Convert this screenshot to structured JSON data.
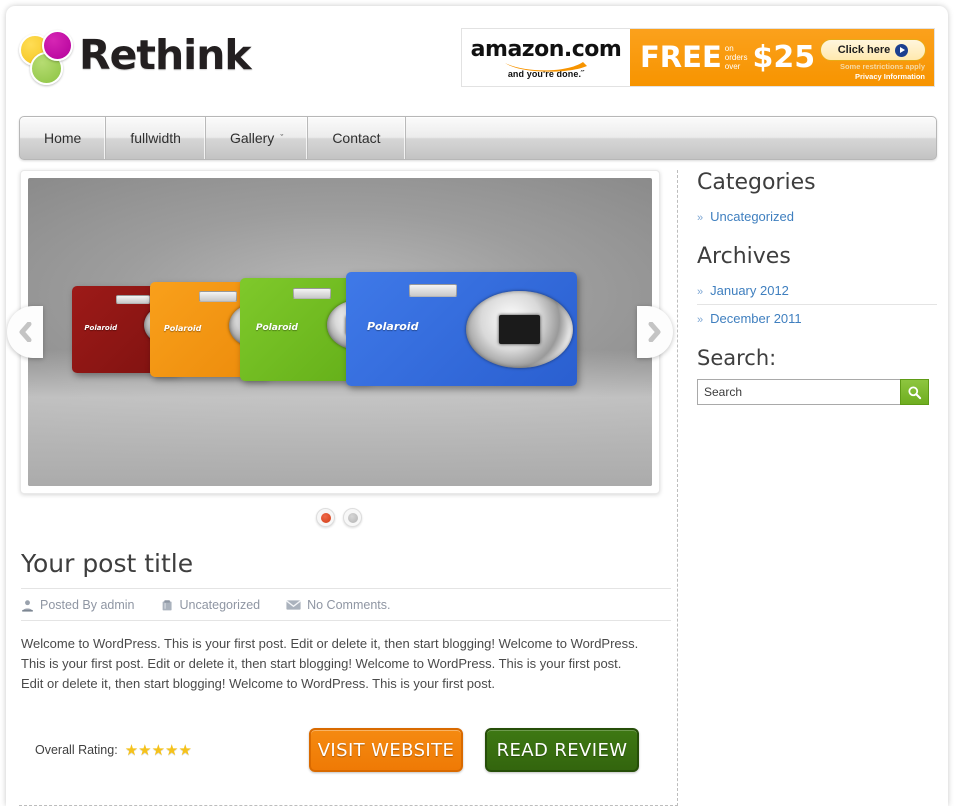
{
  "site": {
    "logo_text": "Rethink",
    "logo_dots": [
      "yellow-dot",
      "magenta-dot",
      "green-dot"
    ]
  },
  "banner": {
    "brand": "amazon",
    "domain": ".com",
    "tagline": "and you're done.˝",
    "free": "FREE",
    "on": "on",
    "orders": "orders",
    "over": "over",
    "price": "$25",
    "cta": "Click here",
    "restrictions": "Some restrictions apply",
    "privacy": "Privacy Information"
  },
  "nav": {
    "items": [
      {
        "label": "Home",
        "has_caret": false
      },
      {
        "label": "fullwidth",
        "has_caret": false
      },
      {
        "label": "Gallery",
        "has_caret": true
      },
      {
        "label": "Contact",
        "has_caret": false
      }
    ],
    "caret_glyph": "ˇ"
  },
  "slider": {
    "alt": "Four Polaroid compact cameras in red, orange, green and blue on a gray studio background",
    "prev_label": "‹",
    "next_label": "›",
    "cameras": [
      {
        "name": "polaroid-camera-red",
        "brand": "Polaroid",
        "color": "#9d1a18"
      },
      {
        "name": "polaroid-camera-orange",
        "brand": "Polaroid",
        "color": "#f9a01b"
      },
      {
        "name": "polaroid-camera-green",
        "brand": "Polaroid",
        "color": "#7fc92b"
      },
      {
        "name": "polaroid-camera-blue",
        "brand": "Polaroid",
        "color": "#3f79e8"
      }
    ],
    "pager": [
      {
        "label": "1",
        "active": true
      },
      {
        "label": "2",
        "active": false
      }
    ]
  },
  "post": {
    "title": "Your post title",
    "meta": {
      "author": "Posted By admin",
      "category": "Uncategorized",
      "comments": "No Comments."
    },
    "body": "Welcome to WordPress. This is your first post. Edit or delete it, then start blogging! Welcome to WordPress. This is your first post. Edit or delete it, then start blogging! Welcome to WordPress. This is your first post. Edit or delete it, then start blogging! Welcome to WordPress. This is your first post.",
    "rating_label": "Overall Rating:",
    "rating_value": 5,
    "rating_max": 5,
    "star_glyph": "★",
    "visit_button": "VISIT WEBSITE",
    "read_button": "READ REVIEW"
  },
  "sidebar": {
    "categories": {
      "title": "Categories",
      "bullet": "»",
      "items": [
        {
          "label": "Uncategorized"
        }
      ]
    },
    "archives": {
      "title": "Archives",
      "bullet": "»",
      "items": [
        {
          "label": "January 2012"
        },
        {
          "label": "December 2011"
        }
      ]
    },
    "search": {
      "title": "Search:",
      "value": "Search",
      "placeholder": "Search",
      "button_icon": "magnifier-icon"
    }
  },
  "colors": {
    "accent_orange": "#ef7a05",
    "accent_green": "#33650e",
    "link_blue": "#3f7fbf",
    "star_gold": "#f5c21b",
    "banner_orange": "#f79400",
    "search_green": "#8dc63f"
  }
}
